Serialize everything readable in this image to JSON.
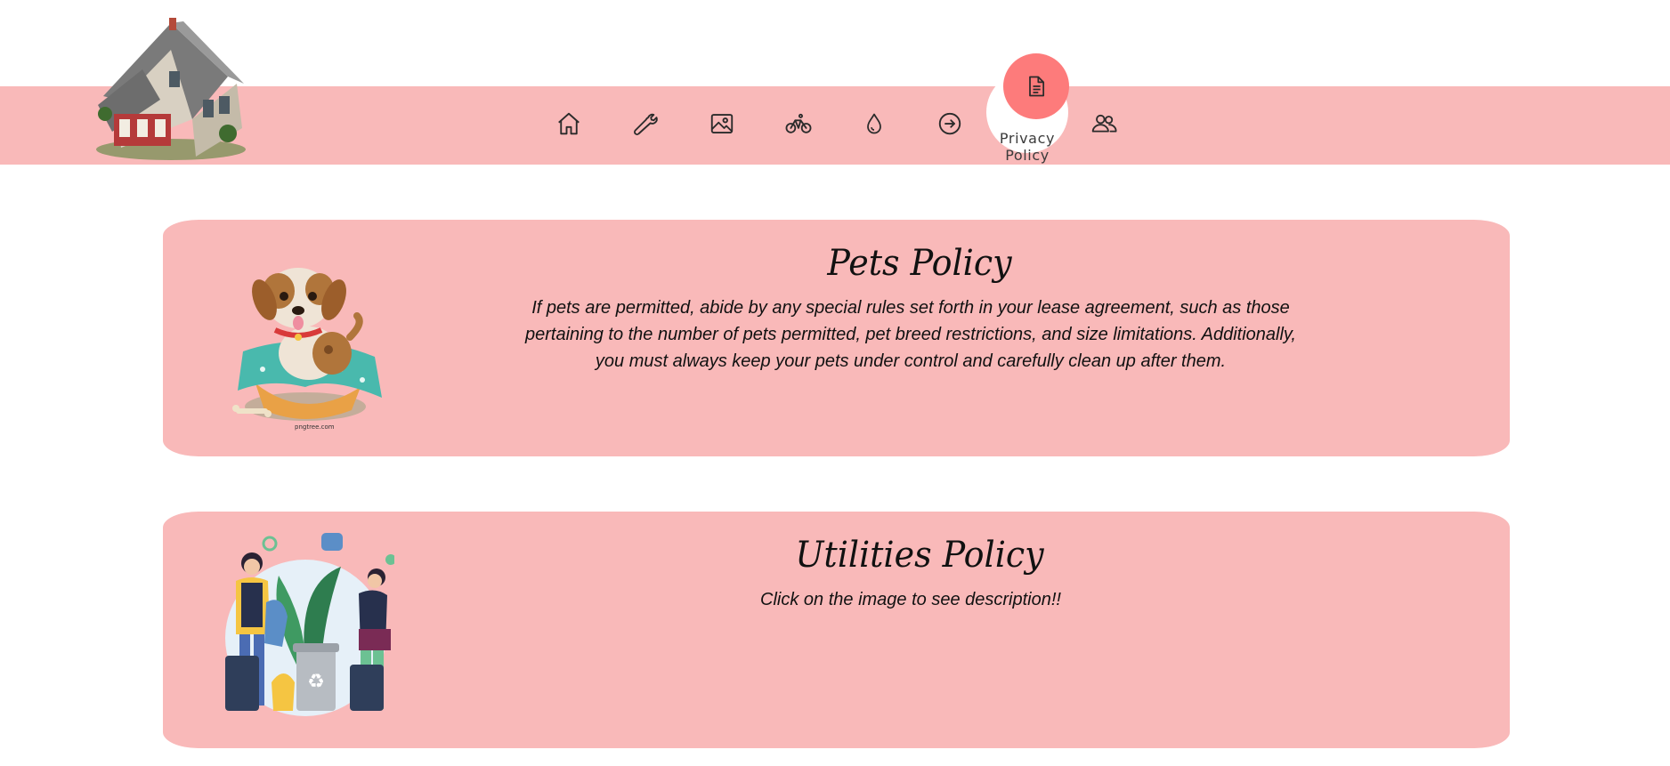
{
  "nav": {
    "items": [
      {
        "icon": "home-icon"
      },
      {
        "icon": "wrench-icon"
      },
      {
        "icon": "image-icon"
      },
      {
        "icon": "bicycle-icon"
      },
      {
        "icon": "water-drop-icon"
      },
      {
        "icon": "arrow-right-circle-icon"
      },
      {
        "icon": "document-icon",
        "label": "Privacy Policy",
        "active": true
      },
      {
        "icon": "users-icon"
      }
    ]
  },
  "cards": [
    {
      "title": "Pets Policy",
      "text": "If pets are permitted, abide by any special rules set forth in your lease agreement, such as those pertaining to the number of pets permitted, pet breed restrictions, and size limitations. Additionally, you must always keep your pets under control and carefully clean up after them.",
      "image": "puppy-illustration",
      "image_caption": "pngtree.com"
    },
    {
      "title": "Utilities Policy",
      "text": "Click on the image to see description!!",
      "image": "recycling-illustration"
    }
  ],
  "colors": {
    "band": "#f9b9b9",
    "active": "#fd7b7b"
  }
}
